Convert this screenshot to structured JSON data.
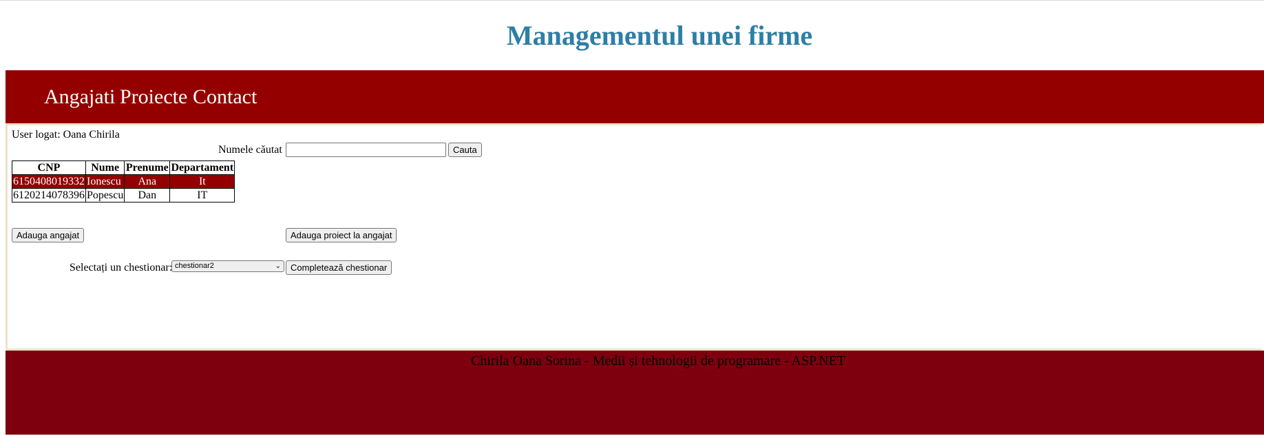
{
  "header": {
    "title": "Managementul unei firme"
  },
  "nav": {
    "items": [
      {
        "label": "Angajati"
      },
      {
        "label": "Proiecte"
      },
      {
        "label": "Contact"
      }
    ]
  },
  "main": {
    "user_label": "User logat: Oana Chirila",
    "search": {
      "label": "Numele căutat",
      "value": "",
      "placeholder": "",
      "button_label": "Cauta"
    },
    "table": {
      "headers": [
        "CNP",
        "Nume",
        "Prenume",
        "Departament"
      ],
      "rows": [
        {
          "cnp": "6150408019332",
          "nume": "Ionescu",
          "prenume": "Ana",
          "departament": "It",
          "selected": true
        },
        {
          "cnp": "6120214078396",
          "nume": "Popescu",
          "prenume": "Dan",
          "departament": "IT",
          "selected": false
        }
      ]
    },
    "add_employee_label": "Adauga angajat",
    "add_project_label": "Adauga proiect la angajat",
    "questionnaire": {
      "label": "Selectați un chestionar:",
      "selected_value": "chestionar2",
      "button_label": "Completează chestionar"
    }
  },
  "footer": {
    "text": "Chirila Oana Sorina - Medii și tehnologii de programare - ASP.NET"
  },
  "colors": {
    "title": "#2e7ea6",
    "nav_bg": "#940000",
    "selected_row_bg": "#940000",
    "footer_bg": "#7e000f",
    "content_border": "#efe2c8"
  },
  "icons": {
    "select_chevron": "chevron-down-icon"
  }
}
